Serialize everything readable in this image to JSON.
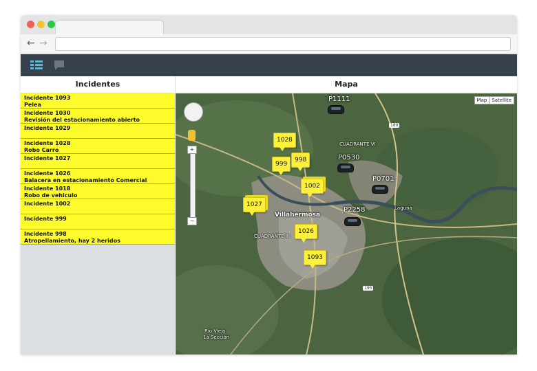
{
  "panels": {
    "incidents_title": "Incidentes",
    "map_title": "Mapa"
  },
  "incidents": [
    {
      "title": "Incidente 1093",
      "desc": "Pelea"
    },
    {
      "title": "Incidente 1030",
      "desc": "Revisión del estacionamiento abierto"
    },
    {
      "title": "Incidente 1029",
      "desc": ""
    },
    {
      "title": "Incidente 1028",
      "desc": "Robo Carro"
    },
    {
      "title": "Incidente 1027",
      "desc": ""
    },
    {
      "title": "Incidente 1026",
      "desc": "Balacera en estacionamiento Comercial"
    },
    {
      "title": "Incidente 1018",
      "desc": "Robo de vehiculo"
    },
    {
      "title": "Incidente 1002",
      "desc": ""
    },
    {
      "title": "Incidente 999",
      "desc": ""
    },
    {
      "title": "Incidente 998",
      "desc": "Atropellamiento, hay 2 heridos"
    }
  ],
  "map": {
    "type_map": "Map",
    "type_satellite": "Satellite",
    "zoom_in": "+",
    "zoom_out": "−",
    "places": {
      "villahermosa": "Villahermosa",
      "laguna": "Laguna",
      "cuadrante_vi": "CUADRANTE VI",
      "cuadrante_iii": "CUADRANTE III",
      "rio_viejo": "Rio Viejo",
      "la_seccion": "1a Sección",
      "hwy_180": "180",
      "hwy_195": "195"
    },
    "markers": {
      "m1028": "1028",
      "m999": "999",
      "m998": "998",
      "m1002": "1002",
      "m1027": "1027",
      "m1026": "1026",
      "m1093": "1093"
    },
    "units": {
      "p1111": "P1111",
      "p0530": "P0530",
      "p0701": "P0701",
      "p2258": "P2258"
    }
  },
  "colors": {
    "incident_bg": "#fdfb2c",
    "app_bar": "#37414b",
    "marker": "#fdf03a"
  }
}
